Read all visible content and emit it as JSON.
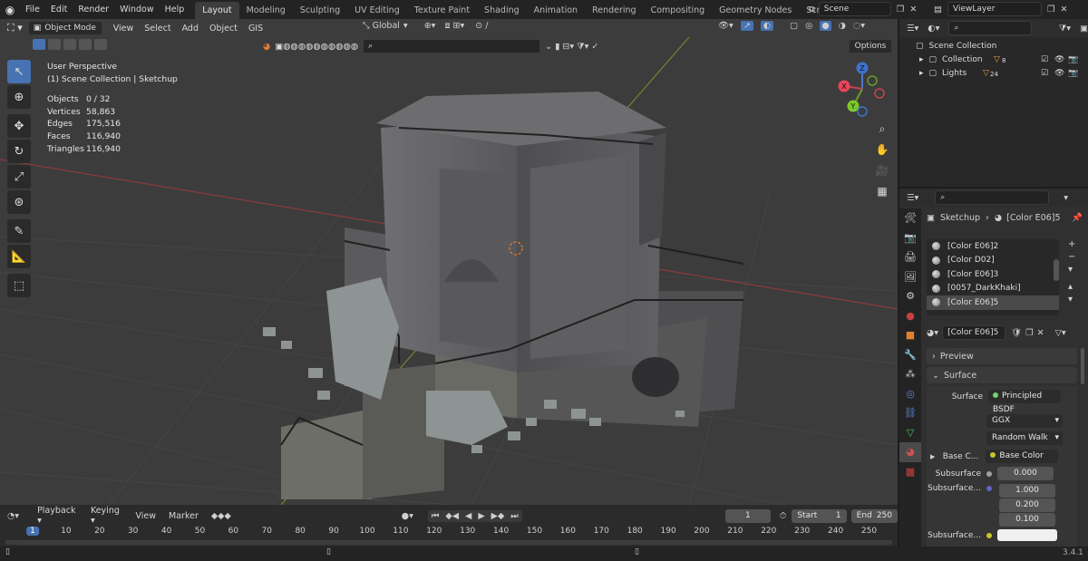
{
  "topbar": {
    "menus": [
      "File",
      "Edit",
      "Render",
      "Window",
      "Help"
    ],
    "workspaces": [
      "Layout",
      "Modeling",
      "Sculpting",
      "UV Editing",
      "Texture Paint",
      "Shading",
      "Animation",
      "Rendering",
      "Compositing",
      "Geometry Nodes",
      "Scripting"
    ],
    "active_workspace": "Layout",
    "add_tab": "+",
    "scene": "Scene",
    "view_layer": "ViewLayer"
  },
  "viewport": {
    "mode": "Object Mode",
    "menus": [
      "View",
      "Select",
      "Add",
      "Object",
      "GIS"
    ],
    "orientation": "Global",
    "options": "Options",
    "view_name": "User Perspective",
    "collection_line": "(1) Scene Collection | Sketchup",
    "stats": [
      {
        "label": "Objects",
        "value": "0 / 32"
      },
      {
        "label": "Vertices",
        "value": "58,863"
      },
      {
        "label": "Edges",
        "value": "175,516"
      },
      {
        "label": "Faces",
        "value": "116,940"
      },
      {
        "label": "Triangles",
        "value": "116,940"
      }
    ],
    "gizmo_axes": [
      "Z",
      "Y",
      "X"
    ]
  },
  "outliner": {
    "root": "Scene Collection",
    "items": [
      {
        "label": "Collection",
        "badge": "8"
      },
      {
        "label": "Lights",
        "badge": "24"
      }
    ]
  },
  "properties": {
    "breadcrumb_object": "Sketchup",
    "breadcrumb_material": "[Color E06]5",
    "materials": [
      "[Color E06]2",
      "[Color D02]",
      "[Color E06]3",
      "[0057_DarkKhaki]",
      "[Color E06]5"
    ],
    "selected_material": "[Color E06]5",
    "material_field": "[Color E06]5",
    "panels": {
      "preview": "Preview",
      "surface": "Surface"
    },
    "surface_label": "Surface",
    "surface_value": "Principled BSDF",
    "distribution": "GGX",
    "subsurface_method": "Random Walk",
    "base_color_label": "Base C...",
    "base_color_value": "Base Color",
    "subsurface_label": "Subsurface",
    "subsurface_value": "0.000",
    "subsurface_radius_label": "Subsurface...",
    "subsurface_radius": [
      "1.000",
      "0.200",
      "0.100"
    ],
    "subsurface_color_label": "Subsurface...",
    "colors": {
      "accent": "#4772b3",
      "shader_socket": "#6fd46f",
      "color_socket": "#c7c729",
      "vector_socket": "#6363c7"
    }
  },
  "timeline": {
    "menus": [
      "Playback",
      "Keying",
      "View",
      "Marker"
    ],
    "current_frame": "1",
    "start_label": "Start",
    "start": "1",
    "end_label": "End",
    "end": "250",
    "ticks": [
      "1",
      "10",
      "20",
      "30",
      "40",
      "50",
      "60",
      "70",
      "80",
      "90",
      "100",
      "110",
      "120",
      "130",
      "140",
      "150",
      "160",
      "170",
      "180",
      "190",
      "200",
      "210",
      "220",
      "230",
      "240",
      "250"
    ]
  },
  "status": {
    "version": "3.4.1"
  }
}
